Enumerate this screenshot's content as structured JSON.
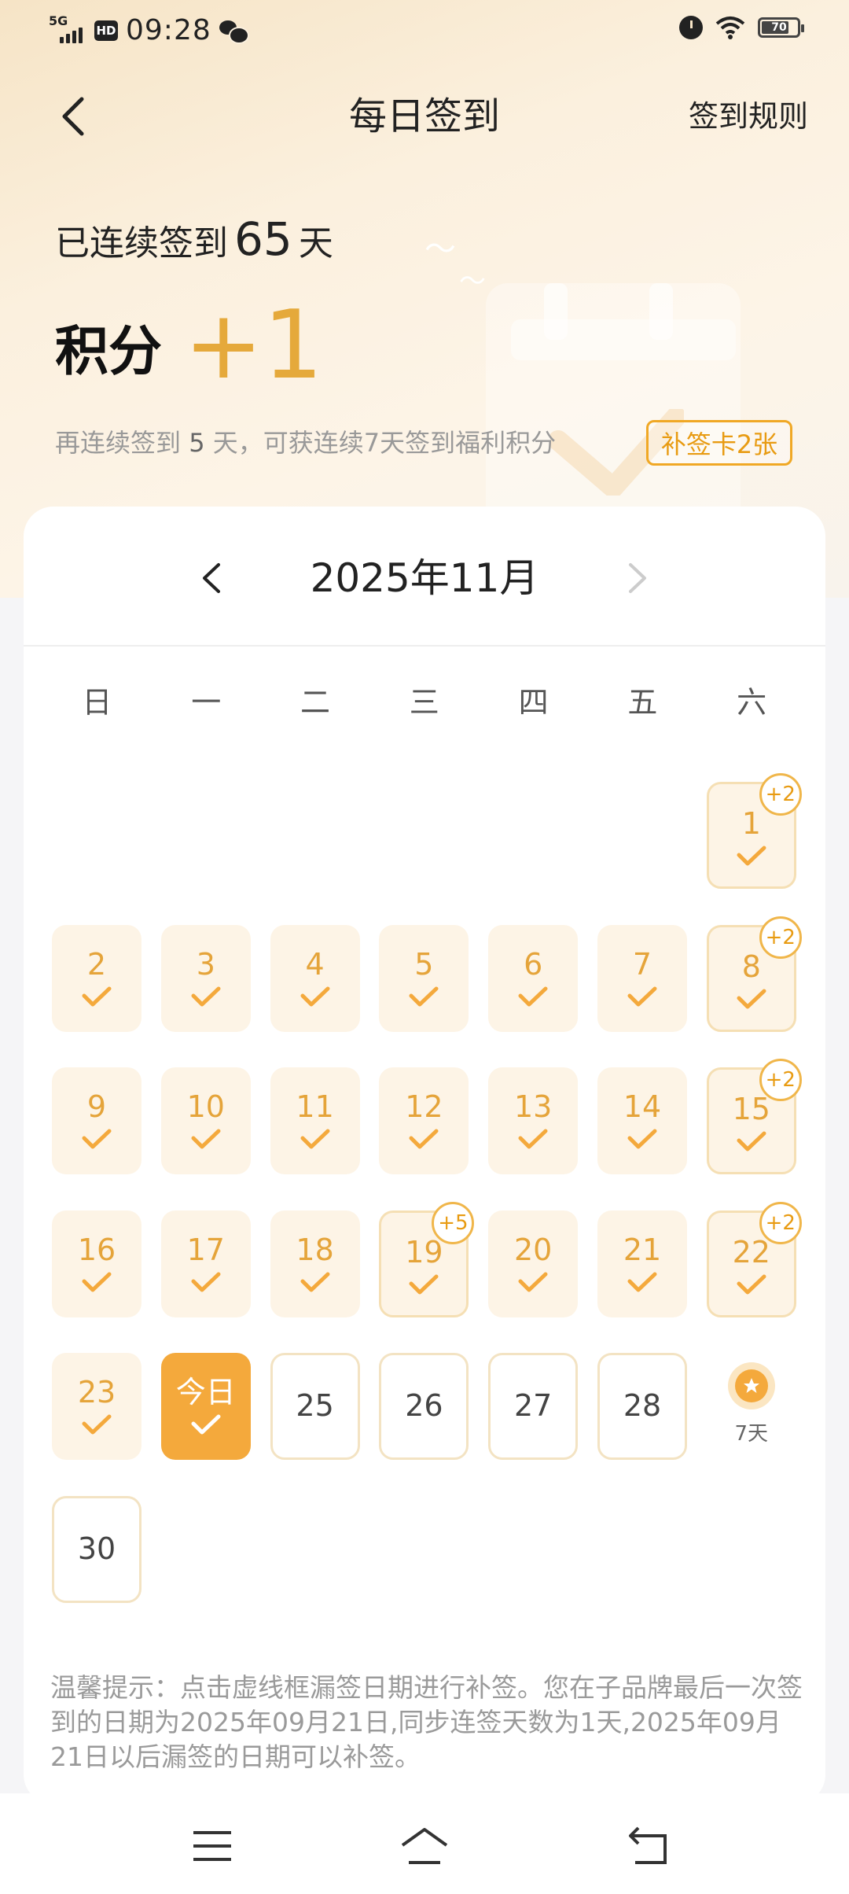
{
  "status_bar": {
    "network": "5G",
    "hd": "HD",
    "time": "09:28",
    "battery": "70"
  },
  "header": {
    "title": "每日签到",
    "rules": "签到规则"
  },
  "summary": {
    "streak_prefix": "已连续签到",
    "streak_days": "65",
    "streak_suffix": "天",
    "points_label": "积分",
    "points_value": "+1",
    "hint_prefix": "再连续签到",
    "hint_days": "5",
    "hint_suffix": "天，可获连续7天签到福利积分",
    "makeup_card": "补签卡2张"
  },
  "calendar": {
    "month": "2025年11月",
    "weekdays": [
      "日",
      "一",
      "二",
      "三",
      "四",
      "五",
      "六"
    ],
    "days": [
      {
        "label": "1",
        "state": "bonus",
        "badge": "+2"
      },
      {
        "label": "2",
        "state": "signed"
      },
      {
        "label": "3",
        "state": "signed"
      },
      {
        "label": "4",
        "state": "signed"
      },
      {
        "label": "5",
        "state": "signed"
      },
      {
        "label": "6",
        "state": "signed"
      },
      {
        "label": "7",
        "state": "signed"
      },
      {
        "label": "8",
        "state": "bonus",
        "badge": "+2"
      },
      {
        "label": "9",
        "state": "signed"
      },
      {
        "label": "10",
        "state": "signed"
      },
      {
        "label": "11",
        "state": "signed"
      },
      {
        "label": "12",
        "state": "signed"
      },
      {
        "label": "13",
        "state": "signed"
      },
      {
        "label": "14",
        "state": "signed"
      },
      {
        "label": "15",
        "state": "bonus",
        "badge": "+2"
      },
      {
        "label": "16",
        "state": "signed"
      },
      {
        "label": "17",
        "state": "signed"
      },
      {
        "label": "18",
        "state": "signed"
      },
      {
        "label": "19",
        "state": "bonus",
        "badge": "+5"
      },
      {
        "label": "20",
        "state": "signed"
      },
      {
        "label": "21",
        "state": "signed"
      },
      {
        "label": "22",
        "state": "bonus",
        "badge": "+2"
      },
      {
        "label": "23",
        "state": "signed"
      },
      {
        "label": "今日",
        "state": "today"
      },
      {
        "label": "25",
        "state": "future"
      },
      {
        "label": "26",
        "state": "future"
      },
      {
        "label": "27",
        "state": "future"
      },
      {
        "label": "28",
        "state": "future"
      },
      {
        "label": "7天",
        "state": "reward"
      },
      {
        "label": "30",
        "state": "future"
      }
    ]
  },
  "tip": "温馨提示：点击虚线框漏签日期进行补签。您在子品牌最后一次签到的日期为2025年09月21日,同步连签天数为1天,2025年09月21日以后漏签的日期可以补签。",
  "colors": {
    "accent": "#f4a93c",
    "accent_text": "#e5a43a",
    "signed_bg": "#fdf4e6"
  }
}
